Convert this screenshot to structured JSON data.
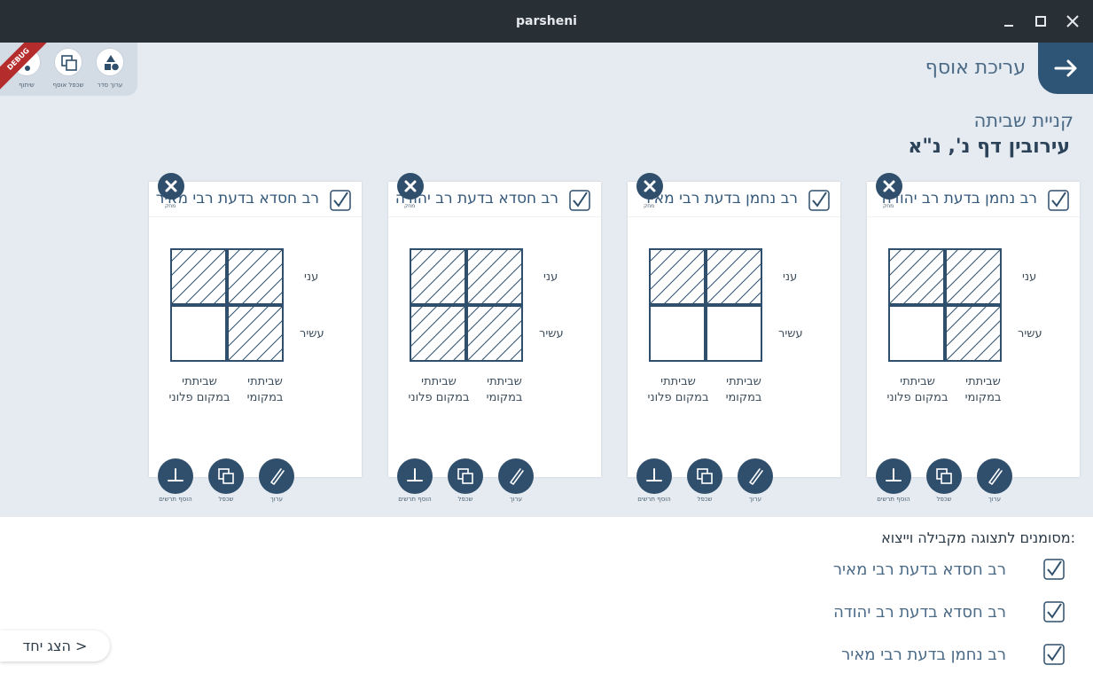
{
  "window": {
    "title": "parsheni"
  },
  "toolbar": {
    "items": [
      {
        "label": "ערוך סדר",
        "icon": "shapes-icon"
      },
      {
        "label": "שכפל אוסף",
        "icon": "duplicate-icon"
      },
      {
        "label": "שיתוף",
        "icon": "share-icon"
      }
    ],
    "debug_ribbon": "DEBUG"
  },
  "header": {
    "title": "עריכת אוסף"
  },
  "collection": {
    "subject": "קניית שביתה",
    "source": "עירובין דף נ', נ\"א"
  },
  "cards": [
    {
      "title": "רב נחמן בדעת רב יהודה",
      "hatched": [
        true,
        true,
        false,
        true
      ]
    },
    {
      "title": "רב נחמן בדעת רבי מאיר",
      "hatched": [
        true,
        true,
        false,
        false
      ]
    },
    {
      "title": "רב חסדא בדעת רב יהודה",
      "hatched": [
        true,
        true,
        true,
        true
      ]
    },
    {
      "title": "רב חסדא בדעת רבי מאיר",
      "hatched": [
        true,
        true,
        false,
        true
      ]
    }
  ],
  "card_labels": {
    "row_poor": "עני",
    "row_rich": "עשיר",
    "col_place_1": "שביתתי",
    "col_place_2": "במקומי",
    "col_other_1": "שביתתי",
    "col_other_2": "במקום פלוני",
    "close_label": "מחק",
    "edit": "ערוך",
    "duplicate": "שכפל",
    "add_diagram": "הוסף תרשים"
  },
  "selected": {
    "title": "מסומנים לתצוגה מקבילה וייצוא:",
    "items": [
      "רב חסדא בדעת רבי מאיר",
      "רב חסדא בדעת רב יהודה",
      "רב נחמן בדעת רבי מאיר"
    ]
  },
  "show_one": "הצג יחד >",
  "colors": {
    "accent": "#2f4f6c",
    "background": "#e5ebf1",
    "titlebar": "#283036"
  }
}
